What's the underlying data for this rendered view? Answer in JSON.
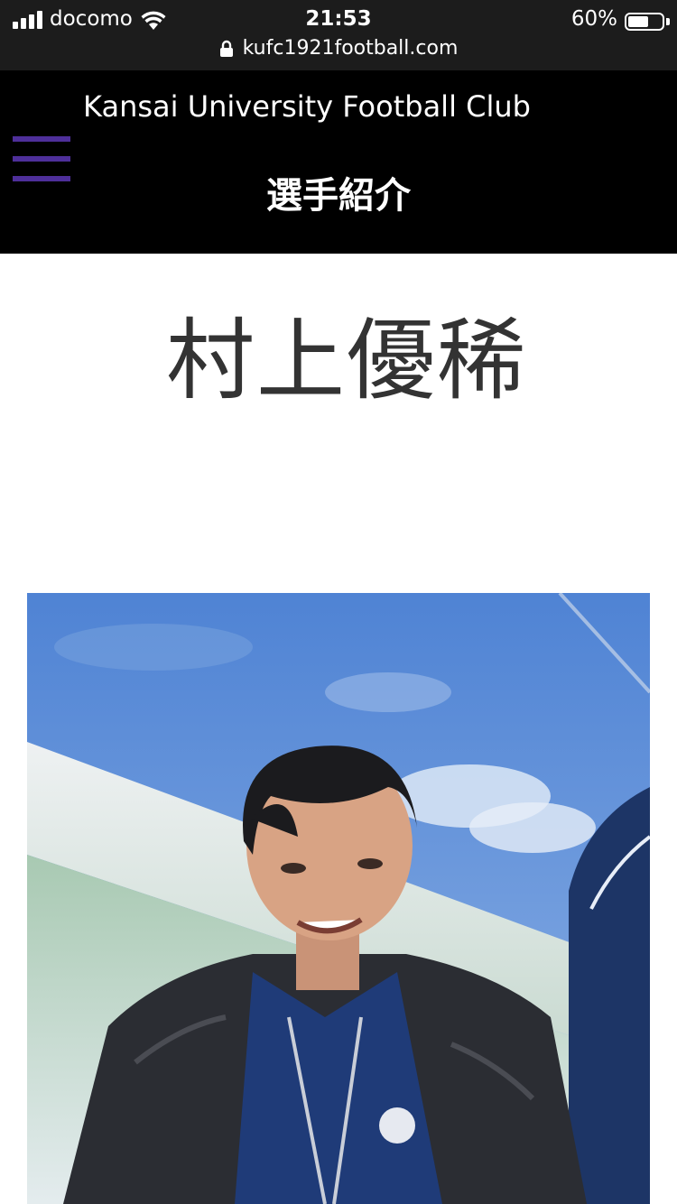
{
  "status_bar": {
    "carrier": "docomo",
    "time": "21:53",
    "battery_percent_text": "60%",
    "battery_level": 0.6,
    "url": "kufc1921football.com"
  },
  "header": {
    "site_name": "Kansai University Football Club",
    "section_title": "選手紹介",
    "menu_icon_color": "#4e2f9a",
    "background_color": "#000000"
  },
  "player": {
    "name": "村上優稀"
  },
  "photo": {
    "description_icon": "player-photo"
  },
  "colors": {
    "text": "#333333",
    "accent": "#4e2f9a"
  }
}
